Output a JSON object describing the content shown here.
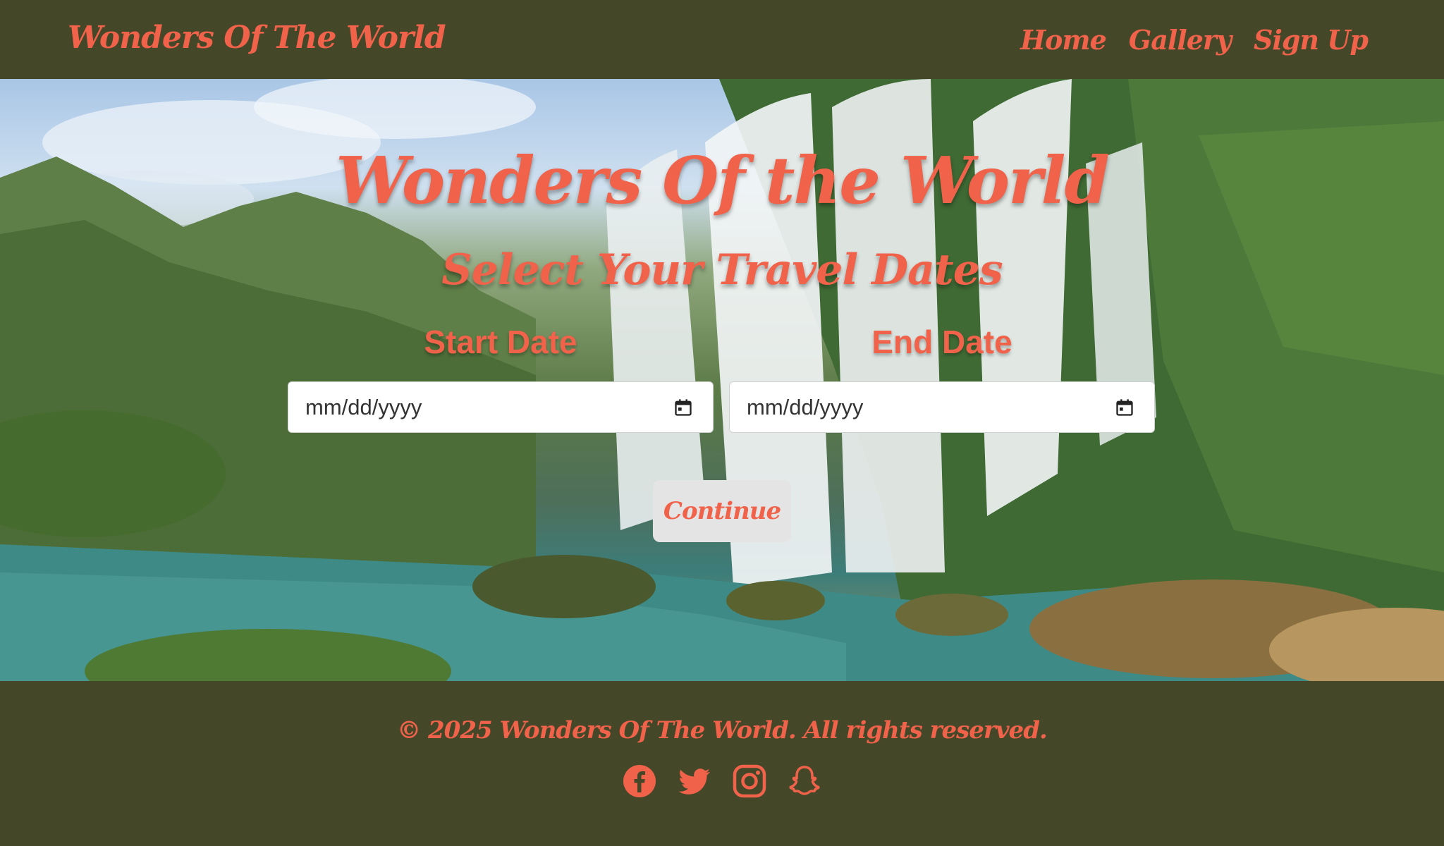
{
  "header": {
    "brand": "Wonders Of The World",
    "nav": [
      {
        "label": "Home"
      },
      {
        "label": "Gallery"
      },
      {
        "label": "Sign Up"
      }
    ]
  },
  "hero": {
    "title": "Wonders Of the World",
    "subtitle": "Select Your Travel Dates",
    "start_label": "Start Date",
    "end_label": "End Date",
    "start_placeholder": "mm/dd/yyyy",
    "end_placeholder": "mm/dd/yyyy",
    "continue_label": "Continue",
    "background_icon": "waterfall-photo"
  },
  "footer": {
    "copyright": "© 2025 Wonders Of The World. All rights reserved.",
    "social": [
      "facebook-icon",
      "twitter-icon",
      "instagram-icon",
      "snapchat-icon"
    ]
  },
  "colors": {
    "accent": "#f0624a",
    "bar_background": "#454729",
    "button_background": "#e4e4e4"
  }
}
